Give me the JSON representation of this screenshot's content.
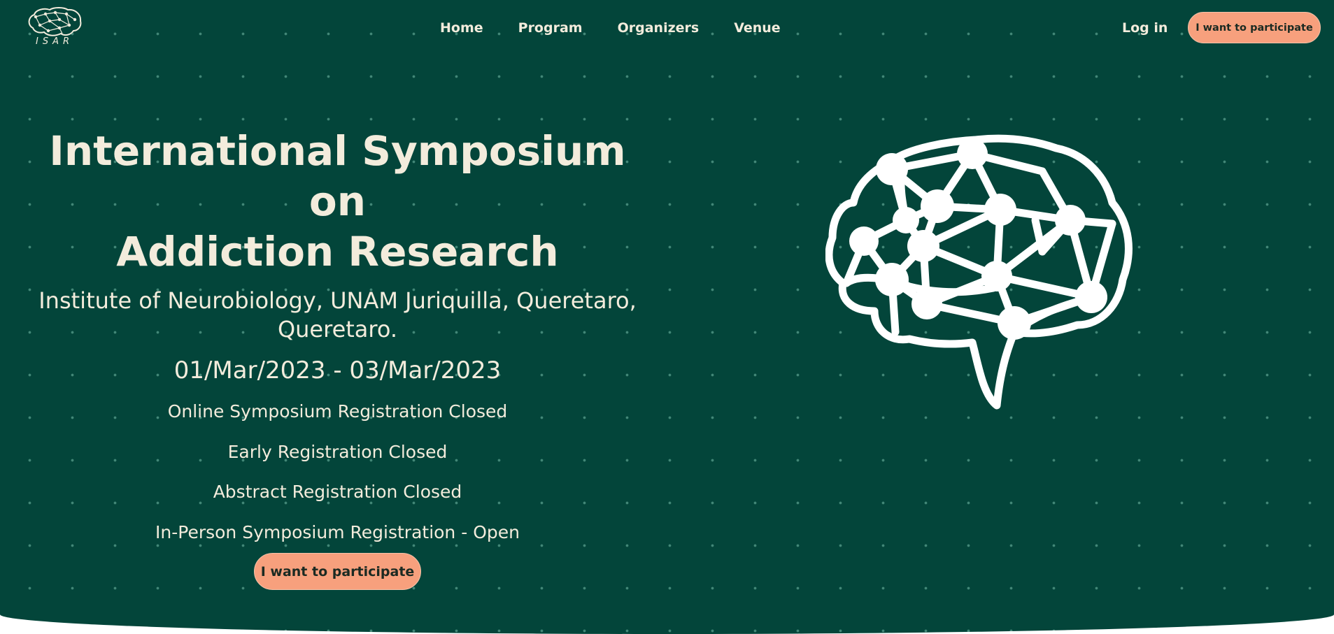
{
  "header": {
    "logo_text": "ISAR",
    "nav": [
      "Home",
      "Program",
      "Organizers",
      "Venue"
    ],
    "login_label": "Log in",
    "cta_label": "I want to participate"
  },
  "hero": {
    "title_line1": "International Symposium on",
    "title_line2": "Addiction Research",
    "subtitle_line1": "Institute of Neurobiology, UNAM Juriquilla, Queretaro,",
    "subtitle_line2": "Queretaro.",
    "dates": "01/Mar/2023 - 03/Mar/2023",
    "statuses": [
      "Online Symposium Registration Closed",
      "Early Registration Closed",
      "Abstract Registration Closed",
      "In-Person Symposium Registration - Open"
    ],
    "cta_label": "I want to participate"
  },
  "icons": {
    "logo": "brain-network-icon",
    "illustration": "brain-network-icon"
  },
  "colors": {
    "background": "#03453a",
    "accent": "#f7a07d",
    "text": "#f3ecdc"
  }
}
